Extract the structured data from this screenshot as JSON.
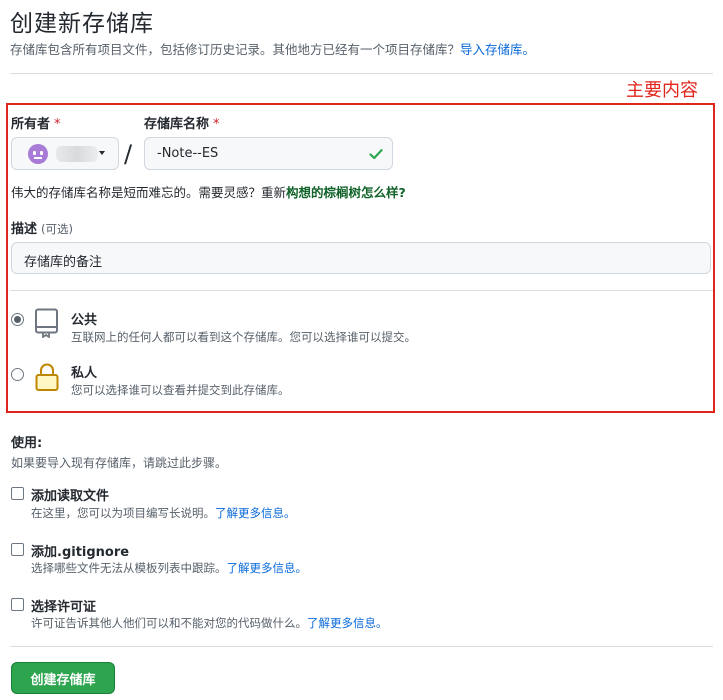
{
  "page": {
    "title": "创建新存储库",
    "subtitle_text": "存储库包含所有项目文件，包括修订历史记录。其他地方已经有一个项目存储库？",
    "subtitle_link": "导入存储库。"
  },
  "annotation": {
    "label": "主要内容",
    "color": "#e0251b"
  },
  "owner": {
    "label": "所有者",
    "required_mark": "*"
  },
  "repo_name": {
    "label": "存储库名称",
    "required_mark": "*",
    "value": "-Note--ES",
    "status_icon": "check-icon"
  },
  "hint": {
    "text": "伟大的存储库名称是短而难忘的。需要灵感？重新",
    "suggestion": "构想的棕榈树怎么样?"
  },
  "description": {
    "label": "描述",
    "optional": "(可选)",
    "value": "存储库的备注"
  },
  "visibility": [
    {
      "title": "公共",
      "desc": "互联网上的任何人都可以看到这个存储库。您可以选择谁可以提交。",
      "checked": true,
      "icon": "repo-book-icon"
    },
    {
      "title": "私人",
      "desc": "您可以选择谁可以查看并提交到此存储库。",
      "checked": false,
      "icon": "lock-icon"
    }
  ],
  "init": {
    "title": "使用:",
    "desc": "如果要导入现有存储库，请跳过此步骤。",
    "options": [
      {
        "title": "添加读取文件",
        "desc": "在这里，您可以为项目编写长说明。",
        "link": "了解更多信息。"
      },
      {
        "title": "添加.gitignore",
        "desc": "选择哪些文件无法从模板列表中跟踪。",
        "link": "了解更多信息。"
      },
      {
        "title": "选择许可证",
        "desc": "许可证告诉其他人他们可以和不能对您的代码做什么。",
        "link": "了解更多信息。"
      }
    ]
  },
  "submit": {
    "label": "创建存储库"
  },
  "colors": {
    "accent_green": "#2da44e",
    "link_blue": "#0969da",
    "suggestion_green": "#116329",
    "required_red": "#cf222e"
  }
}
